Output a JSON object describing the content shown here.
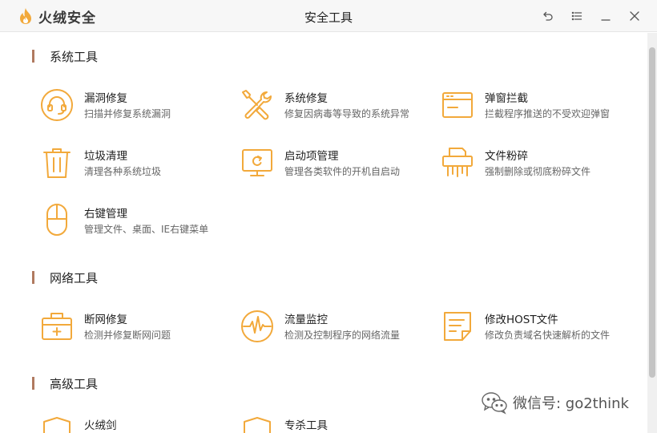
{
  "app": {
    "name": "火绒安全",
    "window_title": "安全工具"
  },
  "window_controls": [
    {
      "name": "back-button",
      "icon": "undo-arrow-icon"
    },
    {
      "name": "menu-button",
      "icon": "list-menu-icon"
    },
    {
      "name": "minimize-button",
      "icon": "minimize-icon"
    },
    {
      "name": "close-button",
      "icon": "close-icon"
    }
  ],
  "colors": {
    "accent": "#f2a93b",
    "section_bar": "#b07a60",
    "title_text": "#222222",
    "desc_text": "#666666"
  },
  "sections": [
    {
      "title": "系统工具",
      "tools": [
        {
          "name": "漏洞修复",
          "desc": "扫描并修复系统漏洞",
          "icon": "headset-circle-icon"
        },
        {
          "name": "系统修复",
          "desc": "修复因病毒等导致的系统异常",
          "icon": "wrench-screwdriver-icon"
        },
        {
          "name": "弹窗拦截",
          "desc": "拦截程序推送的不受欢迎弹窗",
          "icon": "popup-window-icon"
        },
        {
          "name": "垃圾清理",
          "desc": "清理各种系统垃圾",
          "icon": "trash-can-icon"
        },
        {
          "name": "启动项管理",
          "desc": "管理各类软件的开机自启动",
          "icon": "monitor-startup-icon"
        },
        {
          "name": "文件粉碎",
          "desc": "强制删除或彻底粉碎文件",
          "icon": "shredder-icon"
        },
        {
          "name": "右键管理",
          "desc": "管理文件、桌面、IE右键菜单",
          "icon": "mouse-icon"
        }
      ]
    },
    {
      "title": "网络工具",
      "tools": [
        {
          "name": "断网修复",
          "desc": "检测并修复断网问题",
          "icon": "toolbox-plus-icon"
        },
        {
          "name": "流量监控",
          "desc": "检测及控制程序的网络流量",
          "icon": "waveform-circle-icon"
        },
        {
          "name": "修改HOST文件",
          "desc": "修改负责域名快速解析的文件",
          "icon": "host-file-icon"
        }
      ]
    },
    {
      "title": "高级工具",
      "tools": [
        {
          "name": "火绒剑",
          "desc": "",
          "icon": "shield-icon"
        },
        {
          "name": "专杀工具",
          "desc": "",
          "icon": "shield-icon"
        }
      ]
    }
  ],
  "watermark": {
    "text": "微信号: go2think",
    "icon": "wechat-icon"
  }
}
